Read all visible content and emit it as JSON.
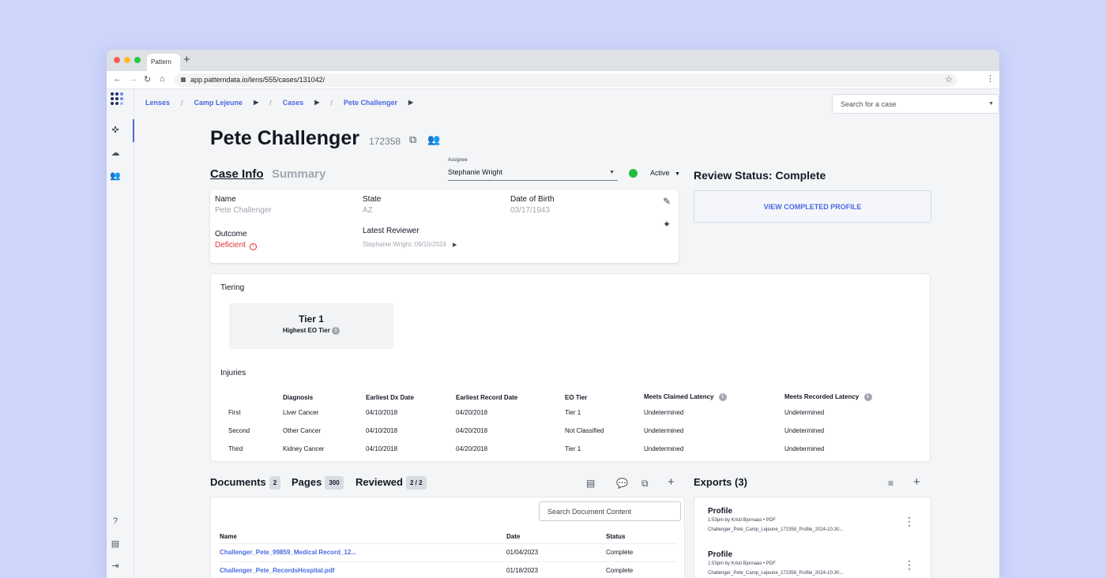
{
  "browser": {
    "tab_title": "Pattern",
    "url": "app.patterndata.io/lens/555/cases/131042/"
  },
  "breadcrumbs": [
    "Lenses",
    "Camp Lejeune",
    "Cases",
    "Pete Challenger"
  ],
  "search": {
    "placeholder": "Search for a case"
  },
  "case": {
    "name": "Pete Challenger",
    "id": "172358"
  },
  "tabs": {
    "case_info": "Case Info",
    "summary": "Summary"
  },
  "assignee": {
    "label": "Assignee",
    "value": "Stephanie Wright"
  },
  "status": {
    "value": "Active",
    "color": "#1fbf3a"
  },
  "review": {
    "title": "Review Status: Complete",
    "button": "VIEW COMPLETED PROFILE"
  },
  "info": {
    "name_label": "Name",
    "name_value": "Pete Challenger",
    "state_label": "State",
    "state_value": "AZ",
    "dob_label": "Date of Birth",
    "dob_value": "03/17/1943",
    "outcome_label": "Outcome",
    "outcome_value": "Deficient",
    "reviewer_label": "Latest Reviewer",
    "reviewer_value": "Stephanie Wright: 09/10/2024"
  },
  "tiering": {
    "label": "Tiering",
    "tier": "Tier 1",
    "subtitle": "Highest EO Tier"
  },
  "injuries": {
    "label": "Injuries",
    "headers": [
      "",
      "Diagnosis",
      "Earliest Dx Date",
      "Earliest Record Date",
      "EO Tier",
      "Meets Claimed Latency",
      "Meets Recorded Latency"
    ],
    "rows": [
      [
        "First",
        "Liver Cancer",
        "04/10/2018",
        "04/20/2018",
        "Tier 1",
        "Undetermined",
        "Undetermined"
      ],
      [
        "Second",
        "Other Cancer",
        "04/10/2018",
        "04/20/2018",
        "Not Classified",
        "Undetermined",
        "Undetermined"
      ],
      [
        "Third",
        "Kidney Cancer",
        "04/10/2018",
        "04/20/2018",
        "Tier 1",
        "Undetermined",
        "Undetermined"
      ]
    ]
  },
  "counts": {
    "documents_label": "Documents",
    "documents": "2",
    "pages_label": "Pages",
    "pages": "300",
    "reviewed_label": "Reviewed",
    "reviewed": "2 / 2"
  },
  "documents": {
    "search_placeholder": "Search Document Content",
    "headers": [
      "Name",
      "Date",
      "Status"
    ],
    "rows": [
      [
        "Challenger_Pete_99859_Medical Record_12...",
        "01/04/2023",
        "Complete"
      ],
      [
        "Challenger_Pete_RecordsHospital.pdf",
        "01/18/2023",
        "Complete"
      ]
    ]
  },
  "exports": {
    "title": "Exports (3)",
    "items": [
      {
        "name": "Profile",
        "meta": "1:53pm by Kristi Bjornaas • PDF",
        "file": "Challenger_Pete_Camp_Lejeune_172358_Profile_2024-10-30..."
      },
      {
        "name": "Profile",
        "meta": "1:53pm by Kristi Bjornaas • PDF",
        "file": "Challenger_Pete_Camp_Lejeune_172358_Profile_2024-10-30..."
      }
    ]
  }
}
